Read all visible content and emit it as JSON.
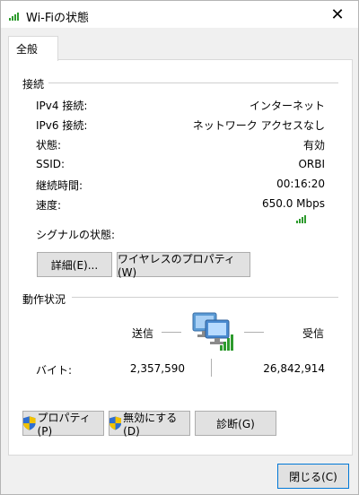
{
  "window": {
    "title": "Wi-Fiの状態",
    "close_glyph": "✕"
  },
  "tab": {
    "label": "全般"
  },
  "connection": {
    "heading": "接続",
    "rows": [
      {
        "label": "IPv4 接続:",
        "value": "インターネット"
      },
      {
        "label": "IPv6 接続:",
        "value": "ネットワーク アクセスなし"
      },
      {
        "label": "状態:",
        "value": "有効"
      },
      {
        "label": "SSID:",
        "value": "ORBI"
      },
      {
        "label": "継続時間:",
        "value": "00:16:20"
      },
      {
        "label": "速度:",
        "value": "650.0 Mbps"
      }
    ],
    "signal_label": "シグナルの状態:",
    "signal_bars": 4,
    "details_button": "詳細(E)...",
    "wireless_button": "ワイヤレスのプロパティ(W)"
  },
  "activity": {
    "heading": "動作状況",
    "sent_label": "送信",
    "received_label": "受信",
    "bytes_label": "バイト:",
    "sent_bytes": "2,357,590",
    "received_bytes": "26,842,914"
  },
  "buttons": {
    "properties": "プロパティ(P)",
    "disable": "無効にする(D)",
    "diagnose": "診断(G)",
    "close": "閉じる(C)"
  },
  "colors": {
    "signal_green": "#2e9b2e",
    "shield_blue": "#2f6fd1",
    "shield_yellow": "#f2c200"
  }
}
